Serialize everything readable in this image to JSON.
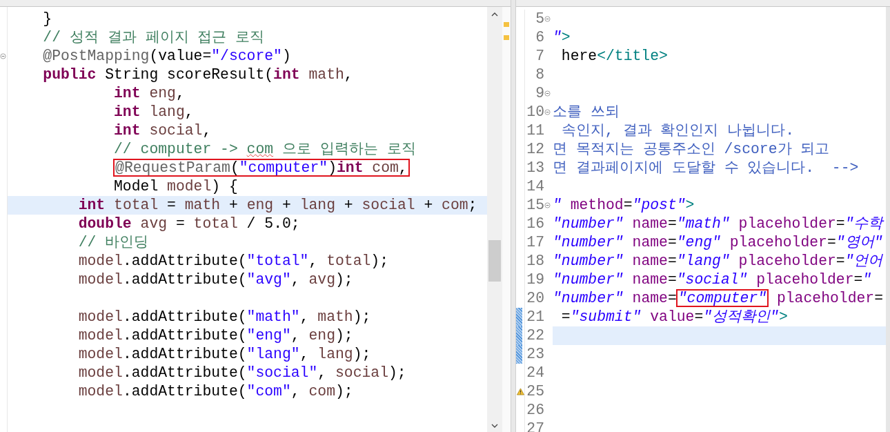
{
  "left_editor": {
    "lines": [
      {
        "current": false,
        "fold": false,
        "tokens": [
          {
            "kind": "plain",
            "text": "    }"
          }
        ]
      },
      {
        "current": false,
        "fold": false,
        "tokens": [
          {
            "kind": "comment",
            "text": "    // 성적 결과 페이지 접근 로직"
          }
        ]
      },
      {
        "current": false,
        "fold": true,
        "tokens": [
          {
            "kind": "annotation",
            "text": "    @PostMapping"
          },
          {
            "kind": "plain",
            "text": "(value="
          },
          {
            "kind": "string",
            "text": "\"/score\""
          },
          {
            "kind": "plain",
            "text": ")"
          }
        ]
      },
      {
        "current": false,
        "fold": false,
        "tokens": [
          {
            "kind": "keyword",
            "text": "    public"
          },
          {
            "kind": "plain",
            "text": " String scoreResult("
          },
          {
            "kind": "keyword",
            "text": "int"
          },
          {
            "kind": "local",
            "text": " math"
          },
          {
            "kind": "plain",
            "text": ","
          }
        ]
      },
      {
        "current": false,
        "fold": false,
        "tokens": [
          {
            "kind": "keyword",
            "text": "            int"
          },
          {
            "kind": "local",
            "text": " eng"
          },
          {
            "kind": "plain",
            "text": ","
          }
        ]
      },
      {
        "current": false,
        "fold": false,
        "tokens": [
          {
            "kind": "keyword",
            "text": "            int"
          },
          {
            "kind": "local",
            "text": " lang"
          },
          {
            "kind": "plain",
            "text": ","
          }
        ]
      },
      {
        "current": false,
        "fold": false,
        "tokens": [
          {
            "kind": "keyword",
            "text": "            int"
          },
          {
            "kind": "local",
            "text": " social"
          },
          {
            "kind": "plain",
            "text": ","
          }
        ]
      },
      {
        "current": false,
        "fold": false,
        "tokens": [
          {
            "kind": "comment",
            "text": "            // computer -> "
          },
          {
            "kind": "comment-typo",
            "text": "com"
          },
          {
            "kind": "comment",
            "text": " 으로 입력하는 로직"
          }
        ]
      },
      {
        "current": false,
        "fold": false,
        "tokens": [
          {
            "kind": "boxed",
            "tokens": [
              {
                "kind": "annotation",
                "text": "            @RequestParam"
              },
              {
                "kind": "plain",
                "text": "("
              },
              {
                "kind": "string",
                "text": "\"computer\""
              },
              {
                "kind": "plain",
                "text": ")"
              },
              {
                "kind": "keyword",
                "text": "int"
              },
              {
                "kind": "local",
                "text": " com"
              },
              {
                "kind": "plain",
                "text": ","
              }
            ]
          }
        ]
      },
      {
        "current": false,
        "fold": false,
        "tokens": [
          {
            "kind": "plain",
            "text": "            Model"
          },
          {
            "kind": "local",
            "text": " model"
          },
          {
            "kind": "plain",
            "text": ") {"
          }
        ]
      },
      {
        "current": true,
        "fold": false,
        "tokens": [
          {
            "kind": "keyword",
            "text": "        int"
          },
          {
            "kind": "local",
            "text": " total"
          },
          {
            "kind": "plain",
            "text": " = "
          },
          {
            "kind": "local",
            "text": "math"
          },
          {
            "kind": "plain",
            "text": " + "
          },
          {
            "kind": "local",
            "text": "eng"
          },
          {
            "kind": "plain",
            "text": " + "
          },
          {
            "kind": "local",
            "text": "lang"
          },
          {
            "kind": "plain",
            "text": " + "
          },
          {
            "kind": "local",
            "text": "social"
          },
          {
            "kind": "plain",
            "text": " + "
          },
          {
            "kind": "local",
            "text": "com"
          },
          {
            "kind": "plain",
            "text": ";"
          }
        ]
      },
      {
        "current": false,
        "fold": false,
        "tokens": [
          {
            "kind": "keyword",
            "text": "        double"
          },
          {
            "kind": "local",
            "text": " avg"
          },
          {
            "kind": "plain",
            "text": " = "
          },
          {
            "kind": "local",
            "text": "total"
          },
          {
            "kind": "plain",
            "text": " / 5.0;"
          }
        ]
      },
      {
        "current": false,
        "fold": false,
        "tokens": [
          {
            "kind": "comment",
            "text": "        // 바인딩"
          }
        ]
      },
      {
        "current": false,
        "fold": false,
        "tokens": [
          {
            "kind": "local",
            "text": "        model"
          },
          {
            "kind": "plain",
            "text": ".addAttribute("
          },
          {
            "kind": "string",
            "text": "\"total\""
          },
          {
            "kind": "plain",
            "text": ", "
          },
          {
            "kind": "local",
            "text": "total"
          },
          {
            "kind": "plain",
            "text": ");"
          }
        ]
      },
      {
        "current": false,
        "fold": false,
        "tokens": [
          {
            "kind": "local",
            "text": "        model"
          },
          {
            "kind": "plain",
            "text": ".addAttribute("
          },
          {
            "kind": "string",
            "text": "\"avg\""
          },
          {
            "kind": "plain",
            "text": ", "
          },
          {
            "kind": "local",
            "text": "avg"
          },
          {
            "kind": "plain",
            "text": ");"
          }
        ]
      },
      {
        "current": false,
        "fold": false
      },
      {
        "current": false,
        "fold": false,
        "tokens": [
          {
            "kind": "local",
            "text": "        model"
          },
          {
            "kind": "plain",
            "text": ".addAttribute("
          },
          {
            "kind": "string",
            "text": "\"math\""
          },
          {
            "kind": "plain",
            "text": ", "
          },
          {
            "kind": "local",
            "text": "math"
          },
          {
            "kind": "plain",
            "text": ");"
          }
        ]
      },
      {
        "current": false,
        "fold": false,
        "tokens": [
          {
            "kind": "local",
            "text": "        model"
          },
          {
            "kind": "plain",
            "text": ".addAttribute("
          },
          {
            "kind": "string",
            "text": "\"eng\""
          },
          {
            "kind": "plain",
            "text": ", "
          },
          {
            "kind": "local",
            "text": "eng"
          },
          {
            "kind": "plain",
            "text": ");"
          }
        ]
      },
      {
        "current": false,
        "fold": false,
        "tokens": [
          {
            "kind": "local",
            "text": "        model"
          },
          {
            "kind": "plain",
            "text": ".addAttribute("
          },
          {
            "kind": "string",
            "text": "\"lang\""
          },
          {
            "kind": "plain",
            "text": ", "
          },
          {
            "kind": "local",
            "text": "lang"
          },
          {
            "kind": "plain",
            "text": ");"
          }
        ]
      },
      {
        "current": false,
        "fold": false,
        "tokens": [
          {
            "kind": "local",
            "text": "        model"
          },
          {
            "kind": "plain",
            "text": ".addAttribute("
          },
          {
            "kind": "string",
            "text": "\"social\""
          },
          {
            "kind": "plain",
            "text": ", "
          },
          {
            "kind": "local",
            "text": "social"
          },
          {
            "kind": "plain",
            "text": ");"
          }
        ]
      },
      {
        "current": false,
        "fold": false,
        "tokens": [
          {
            "kind": "local",
            "text": "        model"
          },
          {
            "kind": "plain",
            "text": ".addAttribute("
          },
          {
            "kind": "string",
            "text": "\"com\""
          },
          {
            "kind": "plain",
            "text": ", "
          },
          {
            "kind": "local",
            "text": "com"
          },
          {
            "kind": "plain",
            "text": ");"
          }
        ]
      }
    ]
  },
  "right_editor": {
    "lines": [
      {
        "number": "5",
        "current": false,
        "fold": true,
        "changed": false,
        "warning": false
      },
      {
        "number": "6",
        "current": false,
        "fold": false,
        "changed": false,
        "warning": false,
        "tokens": [
          {
            "kind": "value",
            "text": "\""
          },
          {
            "kind": "tag",
            "text": ">"
          }
        ]
      },
      {
        "number": "7",
        "current": false,
        "fold": false,
        "changed": false,
        "warning": false,
        "tokens": [
          {
            "kind": "plain",
            "text": " here"
          },
          {
            "kind": "tag",
            "text": "</title>"
          }
        ]
      },
      {
        "number": "8",
        "current": false,
        "fold": false,
        "changed": false,
        "warning": false
      },
      {
        "number": "9",
        "current": false,
        "fold": true,
        "changed": false,
        "warning": false
      },
      {
        "number": "10",
        "current": false,
        "fold": true,
        "changed": false,
        "warning": false,
        "tokens": [
          {
            "kind": "doc",
            "text": "소를 쓰되"
          }
        ]
      },
      {
        "number": "11",
        "current": false,
        "fold": false,
        "changed": false,
        "warning": false,
        "tokens": [
          {
            "kind": "doc",
            "text": " 속인지, 결과 확인인지 나뉩니다."
          }
        ]
      },
      {
        "number": "12",
        "current": false,
        "fold": false,
        "changed": false,
        "warning": false,
        "tokens": [
          {
            "kind": "doc",
            "text": "면 목적지는 공통주소인 /score가 되고"
          }
        ]
      },
      {
        "number": "13",
        "current": false,
        "fold": false,
        "changed": false,
        "warning": false,
        "tokens": [
          {
            "kind": "doc",
            "text": "면 결과페이지에 도달할 수 있습니다.  -->"
          }
        ]
      },
      {
        "number": "14",
        "current": false,
        "fold": false,
        "changed": false,
        "warning": false
      },
      {
        "number": "15",
        "current": false,
        "fold": true,
        "changed": false,
        "warning": false,
        "tokens": [
          {
            "kind": "value",
            "text": "\""
          },
          {
            "kind": "attr",
            "text": " method"
          },
          {
            "kind": "plain",
            "text": "="
          },
          {
            "kind": "value",
            "text": "\"post\""
          },
          {
            "kind": "tag",
            "text": ">"
          }
        ]
      },
      {
        "number": "16",
        "current": false,
        "fold": false,
        "changed": false,
        "warning": false,
        "tokens": [
          {
            "kind": "value",
            "text": "\"number\""
          },
          {
            "kind": "attr",
            "text": " name"
          },
          {
            "kind": "plain",
            "text": "="
          },
          {
            "kind": "value",
            "text": "\"math\""
          },
          {
            "kind": "attr",
            "text": " placeholder"
          },
          {
            "kind": "plain",
            "text": "="
          },
          {
            "kind": "value",
            "text": "\"수학"
          }
        ]
      },
      {
        "number": "17",
        "current": false,
        "fold": false,
        "changed": false,
        "warning": false,
        "tokens": [
          {
            "kind": "value",
            "text": "\"number\""
          },
          {
            "kind": "attr",
            "text": " name"
          },
          {
            "kind": "plain",
            "text": "="
          },
          {
            "kind": "value",
            "text": "\"eng\""
          },
          {
            "kind": "attr",
            "text": " placeholder"
          },
          {
            "kind": "plain",
            "text": "="
          },
          {
            "kind": "value",
            "text": "\"영어\""
          }
        ]
      },
      {
        "number": "18",
        "current": false,
        "fold": false,
        "changed": false,
        "warning": false,
        "tokens": [
          {
            "kind": "value",
            "text": "\"number\""
          },
          {
            "kind": "attr",
            "text": " name"
          },
          {
            "kind": "plain",
            "text": "="
          },
          {
            "kind": "value",
            "text": "\"lang\""
          },
          {
            "kind": "attr",
            "text": " placeholder"
          },
          {
            "kind": "plain",
            "text": "="
          },
          {
            "kind": "value",
            "text": "\"언어"
          }
        ]
      },
      {
        "number": "19",
        "current": false,
        "fold": false,
        "changed": false,
        "warning": false,
        "tokens": [
          {
            "kind": "value",
            "text": "\"number\""
          },
          {
            "kind": "attr",
            "text": " name"
          },
          {
            "kind": "plain",
            "text": "="
          },
          {
            "kind": "value",
            "text": "\"social\""
          },
          {
            "kind": "attr",
            "text": " placeholder"
          },
          {
            "kind": "plain",
            "text": "="
          },
          {
            "kind": "value",
            "text": "\""
          }
        ]
      },
      {
        "number": "20",
        "current": false,
        "fold": false,
        "changed": false,
        "warning": false,
        "tokens": [
          {
            "kind": "value",
            "text": "\"number\""
          },
          {
            "kind": "attr",
            "text": " name"
          },
          {
            "kind": "plain",
            "text": "="
          },
          {
            "kind": "boxed",
            "tokens": [
              {
                "kind": "value",
                "text": "\"computer\""
              }
            ]
          },
          {
            "kind": "attr",
            "text": " placeholder"
          },
          {
            "kind": "plain",
            "text": "="
          }
        ]
      },
      {
        "number": "21",
        "current": false,
        "fold": false,
        "changed": true,
        "warning": false,
        "tokens": [
          {
            "kind": "plain",
            "text": " ="
          },
          {
            "kind": "value",
            "text": "\"submit\""
          },
          {
            "kind": "attr",
            "text": " value"
          },
          {
            "kind": "plain",
            "text": "="
          },
          {
            "kind": "value",
            "text": "\"성적확인\""
          },
          {
            "kind": "tag",
            "text": ">"
          }
        ]
      },
      {
        "number": "22",
        "current": true,
        "fold": false,
        "changed": true,
        "warning": false
      },
      {
        "number": "23",
        "current": false,
        "fold": false,
        "changed": true,
        "warning": false
      },
      {
        "number": "24",
        "current": false,
        "fold": false,
        "changed": false,
        "warning": false
      },
      {
        "number": "25",
        "current": false,
        "fold": false,
        "changed": false,
        "warning": true
      },
      {
        "number": "26",
        "current": false,
        "fold": false,
        "changed": false,
        "warning": false
      },
      {
        "number": "27",
        "current": false,
        "fold": false,
        "changed": false,
        "warning": false
      }
    ]
  }
}
